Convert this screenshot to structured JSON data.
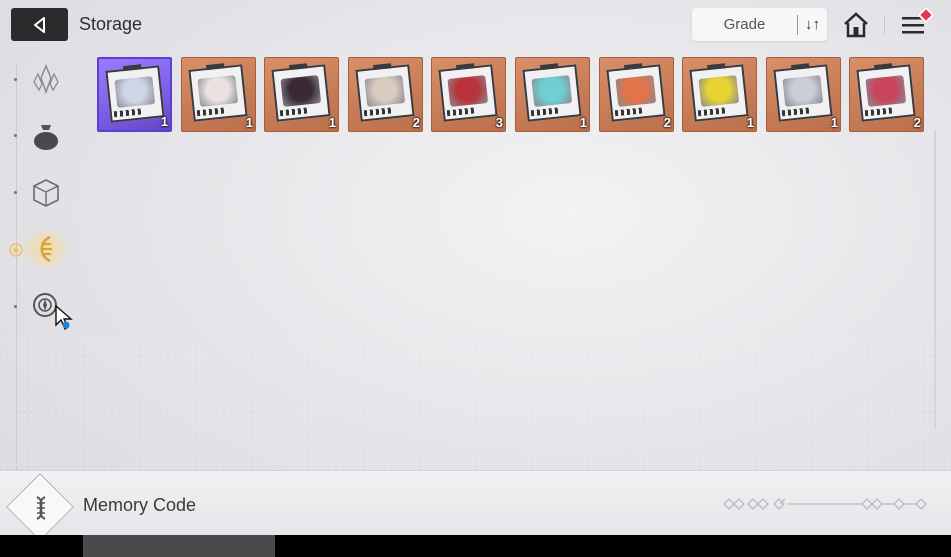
{
  "header": {
    "title": "Storage",
    "sort_label": "Grade",
    "sort_icon": "↓↑"
  },
  "sidebar": {
    "items": [
      {
        "name": "crystal-icon",
        "active": false
      },
      {
        "name": "pouch-icon",
        "active": false
      },
      {
        "name": "cube-icon",
        "active": false
      },
      {
        "name": "memory-code-icon",
        "active": true
      },
      {
        "name": "target-gear-icon",
        "active": false
      }
    ]
  },
  "items": [
    {
      "count": "1",
      "rarity": "purple",
      "portrait": "#cfd4e6"
    },
    {
      "count": "1",
      "rarity": "orange",
      "portrait": "#e9e2e0"
    },
    {
      "count": "1",
      "rarity": "orange",
      "portrait": "#3a2a33"
    },
    {
      "count": "2",
      "rarity": "orange",
      "portrait": "#d8cbbf"
    },
    {
      "count": "3",
      "rarity": "orange",
      "portrait": "#b8333a"
    },
    {
      "count": "1",
      "rarity": "orange",
      "portrait": "#6fcfd2"
    },
    {
      "count": "2",
      "rarity": "orange",
      "portrait": "#e2744a"
    },
    {
      "count": "1",
      "rarity": "orange",
      "portrait": "#e7d433"
    },
    {
      "count": "1",
      "rarity": "orange",
      "portrait": "#c9ced9"
    },
    {
      "count": "2",
      "rarity": "orange",
      "portrait": "#c8455c"
    }
  ],
  "bottom": {
    "label": "Memory Code"
  },
  "colors": {
    "accent_active": "#e6b450",
    "notification": "#e2394b",
    "rarity_orange": "#c67b55",
    "rarity_purple": "#7c5ee3"
  }
}
